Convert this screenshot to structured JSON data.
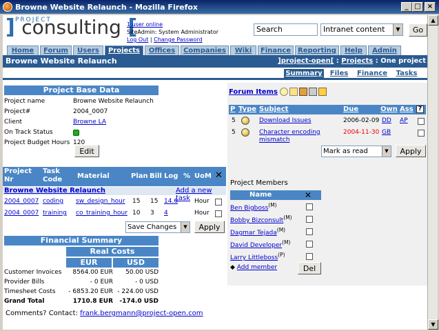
{
  "window": {
    "title": "Browne Website Relaunch - Mozilla Firefox"
  },
  "header": {
    "logo_small": "PROJECT",
    "logo_text": "consulting",
    "users_online": "1 user online",
    "user": "SiteAdmin: System Administrator",
    "logout": "Log Out",
    "change_password": "Change Password",
    "search_value": "Search",
    "search_scope": "Intranet content",
    "go_label": "Go"
  },
  "nav": [
    "Home",
    "Forum",
    "Users",
    "Projects",
    "Offices",
    "Companies",
    "Wiki",
    "Finance",
    "Reporting",
    "Help",
    "Admin"
  ],
  "title_bar": {
    "title": "Browne Website Relaunch",
    "crumb_home": "]project-open[",
    "crumb_sep1": " : ",
    "crumb_projects": "Projects",
    "crumb_sep2": " : One project"
  },
  "subtabs": [
    "Summary",
    "Files",
    "Finance",
    "Tasks"
  ],
  "base_data": {
    "heading": "Project Base Data",
    "rows": [
      {
        "label": "Project name",
        "value": "Browne Website Relaunch"
      },
      {
        "label": "Project#",
        "value": "2004_0007"
      },
      {
        "label": "Client",
        "value": "Browne LA"
      },
      {
        "label": "On Track Status",
        "value": ""
      },
      {
        "label": "Project Budget Hours",
        "value": "120"
      }
    ],
    "edit_label": "Edit"
  },
  "tasks": {
    "headers": [
      "Project Nr",
      "Task Code",
      "Material",
      "Plan",
      "Bill",
      "Log",
      "%",
      "UoM"
    ],
    "group_label": "Browne Website Relaunch",
    "add_task": "Add a new task",
    "rows": [
      {
        "nr": "2004_0007",
        "code": "coding",
        "material": "sw_design_hour",
        "plan": "15",
        "bill": "15",
        "log": "14.6",
        "pct": "",
        "uom": "Hour"
      },
      {
        "nr": "2004_0007",
        "code": "training",
        "material": "co_training_hour",
        "plan": "10",
        "bill": "3",
        "log": "4",
        "pct": "",
        "uom": "Hour"
      }
    ],
    "action_select": "Save Changes",
    "apply_label": "Apply"
  },
  "financial": {
    "heading": "Financial Summary",
    "subheading": "Real Costs",
    "col_eur": "EUR",
    "col_usd": "USD",
    "rows": [
      {
        "label": "Customer Invoices",
        "eur": "8564.00 EUR",
        "usd": "50.00 USD"
      },
      {
        "label": "Provider Bills",
        "eur": "- 0 EUR",
        "usd": "- 0 USD"
      },
      {
        "label": "Timesheet Costs",
        "eur": "- 6853.20 EUR",
        "usd": "- 224.00 USD"
      },
      {
        "label": "Grand Total",
        "eur": "1710.8 EUR",
        "usd": "-174.0 USD"
      }
    ]
  },
  "forum": {
    "heading": "Forum Items",
    "headers": [
      "P",
      "Type",
      "Subject",
      "Due",
      "Own",
      "Ass"
    ],
    "rows": [
      {
        "p": "5",
        "subject": "Download Issues",
        "due": "2006-02-09",
        "own": "DD",
        "ass": "AP",
        "overdue": false
      },
      {
        "p": "5",
        "subject": "Character encoding mismatch",
        "due": "2004-11-30",
        "own": "GB",
        "ass": "",
        "overdue": true
      }
    ],
    "action_select": "Mark as read",
    "apply_label": "Apply"
  },
  "members": {
    "heading": "Project Members",
    "col_name": "Name",
    "list": [
      {
        "name": "Ben Bigboss",
        "role": "(M)"
      },
      {
        "name": "Bobby Bizconsult",
        "role": "(M)"
      },
      {
        "name": "Dagmar Tejada",
        "role": "(M)"
      },
      {
        "name": "David Developer",
        "role": "(M)"
      },
      {
        "name": "Larry Littleboss",
        "role": "(P)"
      }
    ],
    "add_member": "Add member",
    "del_label": "Del"
  },
  "footer": {
    "comments": "Comments? Contact:",
    "email": "frank.bergmann@project-open.com"
  }
}
